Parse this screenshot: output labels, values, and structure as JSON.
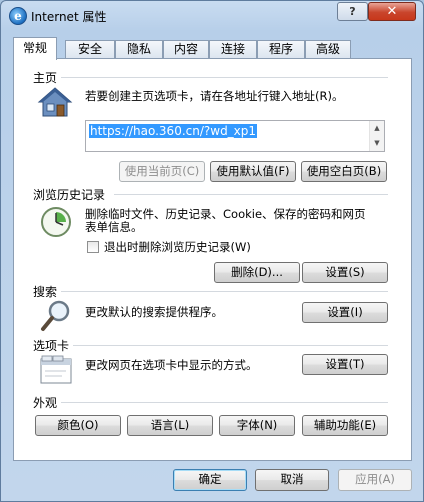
{
  "window": {
    "title": "Internet 属性",
    "help": "?",
    "close": "✕"
  },
  "tabs": [
    {
      "label": "常规",
      "active": true
    },
    {
      "label": "安全"
    },
    {
      "label": "隐私"
    },
    {
      "label": "内容"
    },
    {
      "label": "连接"
    },
    {
      "label": "程序"
    },
    {
      "label": "高级"
    }
  ],
  "homepage": {
    "heading": "主页",
    "description": "若要创建主页选项卡，请在各地址行键入地址(R)。",
    "url": "https://hao.360.cn/?wd_xp1",
    "use_current": "使用当前页(C)",
    "use_default": "使用默认值(F)",
    "use_blank": "使用空白页(B)"
  },
  "history": {
    "heading": "浏览历史记录",
    "description_line1": "删除临时文件、历史记录、Cookie、保存的密码和网页",
    "description_line2": "表单信息。",
    "checkbox_label": "退出时删除浏览历史记录(W)",
    "delete": "删除(D)...",
    "settings": "设置(S)"
  },
  "search": {
    "heading": "搜索",
    "description": "更改默认的搜索提供程序。",
    "settings": "设置(I)"
  },
  "tabs_section": {
    "heading": "选项卡",
    "description": "更改网页在选项卡中显示的方式。",
    "settings": "设置(T)"
  },
  "appearance": {
    "heading": "外观",
    "colors": "颜色(O)",
    "languages": "语言(L)",
    "fonts": "字体(N)",
    "accessibility": "辅助功能(E)"
  },
  "footer": {
    "ok": "确定",
    "cancel": "取消",
    "apply": "应用(A)"
  }
}
